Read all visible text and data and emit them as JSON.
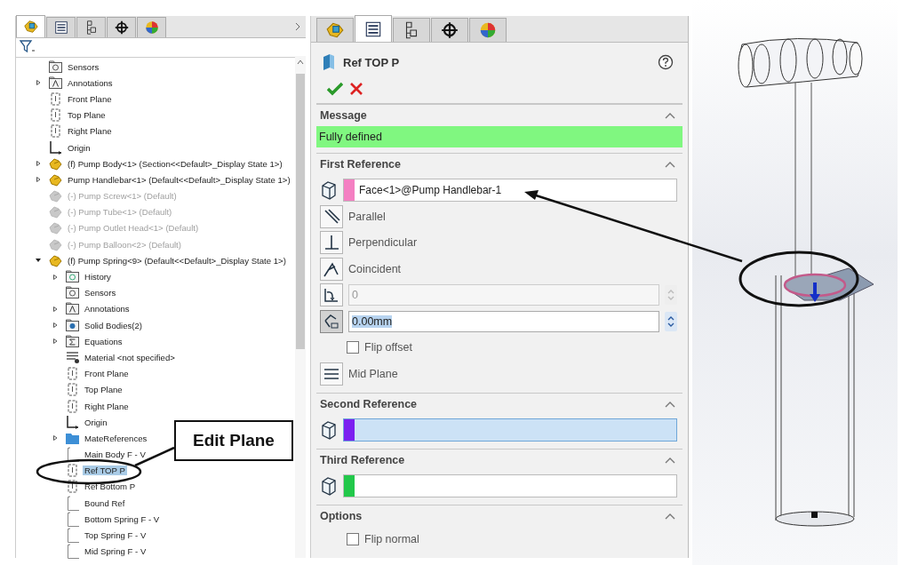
{
  "feature_tree": {
    "tabs": [
      {
        "kind": "part",
        "selected": true
      },
      {
        "kind": "properties",
        "selected": false
      },
      {
        "kind": "configurations",
        "selected": false
      },
      {
        "kind": "dimxpert",
        "selected": false
      },
      {
        "kind": "appearance",
        "selected": false
      }
    ],
    "items": [
      {
        "kind": "sensors",
        "label": "Sensors",
        "expandable": false,
        "expanded": false,
        "suppressed": false,
        "selected": false
      },
      {
        "kind": "annotations",
        "label": "Annotations",
        "expandable": true,
        "expanded": false,
        "suppressed": false,
        "selected": false
      },
      {
        "kind": "plane",
        "label": "Front Plane",
        "expandable": false,
        "expanded": false,
        "suppressed": false,
        "selected": false
      },
      {
        "kind": "plane",
        "label": "Top Plane",
        "expandable": false,
        "expanded": false,
        "suppressed": false,
        "selected": false
      },
      {
        "kind": "plane",
        "label": "Right Plane",
        "expandable": false,
        "expanded": false,
        "suppressed": false,
        "selected": false
      },
      {
        "kind": "origin",
        "label": "Origin",
        "expandable": false,
        "expanded": false,
        "suppressed": false,
        "selected": false
      },
      {
        "kind": "part",
        "label": "(f) Pump Body<1> (Section<<Default>_Display State 1>)",
        "expandable": true,
        "expanded": false,
        "suppressed": false,
        "selected": false
      },
      {
        "kind": "part",
        "label": "Pump Handlebar<1> (Default<<Default>_Display State 1>)",
        "expandable": true,
        "expanded": false,
        "suppressed": false,
        "selected": false
      },
      {
        "kind": "part",
        "label": "(-) Pump Screw<1> (Default)",
        "expandable": false,
        "expanded": false,
        "suppressed": true,
        "selected": false
      },
      {
        "kind": "part",
        "label": "(-) Pump Tube<1> (Default)",
        "expandable": false,
        "expanded": false,
        "suppressed": true,
        "selected": false
      },
      {
        "kind": "part",
        "label": "(-) Pump Outlet Head<1> (Default)",
        "expandable": false,
        "expanded": false,
        "suppressed": true,
        "selected": false
      },
      {
        "kind": "part",
        "label": "(-) Pump Balloon<2> (Default)",
        "expandable": false,
        "expanded": false,
        "suppressed": true,
        "selected": false
      },
      {
        "kind": "part",
        "label": "(f) Pump Spring<9> (Default<<Default>_Display State 1>)",
        "expandable": true,
        "expanded": true,
        "suppressed": false,
        "selected": false,
        "children": [
          {
            "kind": "history",
            "label": "History",
            "expandable": true,
            "expanded": false,
            "suppressed": false,
            "selected": false
          },
          {
            "kind": "sensors",
            "label": "Sensors",
            "expandable": false,
            "expanded": false,
            "suppressed": false,
            "selected": false
          },
          {
            "kind": "annotations",
            "label": "Annotations",
            "expandable": true,
            "expanded": false,
            "suppressed": false,
            "selected": false
          },
          {
            "kind": "bodies",
            "label": "Solid Bodies(2)",
            "expandable": true,
            "expanded": false,
            "suppressed": false,
            "selected": false
          },
          {
            "kind": "equations",
            "label": "Equations",
            "expandable": true,
            "expanded": false,
            "suppressed": false,
            "selected": false
          },
          {
            "kind": "material",
            "label": "Material <not specified>",
            "expandable": false,
            "expanded": false,
            "suppressed": false,
            "selected": false
          },
          {
            "kind": "plane",
            "label": "Front Plane",
            "expandable": false,
            "expanded": false,
            "suppressed": false,
            "selected": false
          },
          {
            "kind": "plane",
            "label": "Top Plane",
            "expandable": false,
            "expanded": false,
            "suppressed": false,
            "selected": false
          },
          {
            "kind": "plane",
            "label": "Right Plane",
            "expandable": false,
            "expanded": false,
            "suppressed": false,
            "selected": false
          },
          {
            "kind": "origin",
            "label": "Origin",
            "expandable": false,
            "expanded": false,
            "suppressed": false,
            "selected": false
          },
          {
            "kind": "folder",
            "label": "MateReferences",
            "expandable": true,
            "expanded": false,
            "suppressed": false,
            "selected": false
          },
          {
            "kind": "sketch",
            "label": "Main Body F - V",
            "expandable": false,
            "expanded": false,
            "suppressed": false,
            "selected": false
          },
          {
            "kind": "plane",
            "label": "Ref TOP P",
            "expandable": false,
            "expanded": false,
            "suppressed": false,
            "selected": true
          },
          {
            "kind": "plane",
            "label": "Ref Bottom P",
            "expandable": false,
            "expanded": false,
            "suppressed": false,
            "selected": false
          },
          {
            "kind": "sketch",
            "label": "Bound Ref",
            "expandable": false,
            "expanded": false,
            "suppressed": false,
            "selected": false
          },
          {
            "kind": "sketch",
            "label": "Bottom Spring F - V",
            "expandable": false,
            "expanded": false,
            "suppressed": false,
            "selected": false
          },
          {
            "kind": "sketch",
            "label": "Top Spring F - V",
            "expandable": false,
            "expanded": false,
            "suppressed": false,
            "selected": false
          },
          {
            "kind": "sketch",
            "label": "Mid Spring F - V",
            "expandable": false,
            "expanded": false,
            "suppressed": false,
            "selected": false
          }
        ]
      }
    ]
  },
  "property_manager": {
    "tabs": [
      {
        "kind": "part",
        "selected": false
      },
      {
        "kind": "properties",
        "selected": true
      },
      {
        "kind": "configurations",
        "selected": false
      },
      {
        "kind": "dimxpert",
        "selected": false
      },
      {
        "kind": "appearance",
        "selected": false
      }
    ],
    "title": "Ref TOP P",
    "sections": [
      {
        "title": "Message",
        "expanded": true,
        "rows": [
          {
            "kind": "message",
            "text": "Fully defined"
          }
        ]
      },
      {
        "title": "First Reference",
        "expanded": true,
        "rows": [
          {
            "kind": "reference",
            "value": "Face<1>@Pump Handlebar-1",
            "color": "#f47fc2",
            "active": false
          },
          {
            "kind": "parallel",
            "label": "Parallel"
          },
          {
            "kind": "perpendicular",
            "label": "Perpendicular"
          },
          {
            "kind": "coincident",
            "label": "Coincident"
          },
          {
            "kind": "angle",
            "value": "0",
            "disabled": true,
            "pressed": false,
            "selected": false
          },
          {
            "kind": "offset",
            "value": "0.00mm",
            "disabled": false,
            "pressed": true,
            "selected": true
          },
          {
            "kind": "checkbox",
            "label": "Flip offset",
            "checked": false
          },
          {
            "kind": "midplane",
            "label": "Mid Plane"
          }
        ]
      },
      {
        "title": "Second Reference",
        "expanded": true,
        "rows": [
          {
            "kind": "reference",
            "value": "",
            "color": "#7b1ff0",
            "active": true
          }
        ]
      },
      {
        "title": "Third Reference",
        "expanded": true,
        "rows": [
          {
            "kind": "reference",
            "value": "",
            "color": "#22c84a",
            "active": false
          }
        ]
      },
      {
        "title": "Options",
        "expanded": true,
        "rows": [
          {
            "kind": "checkbox",
            "label": "Flip normal",
            "checked": false
          }
        ]
      }
    ]
  },
  "callout": {
    "text": "Edit Plane"
  }
}
